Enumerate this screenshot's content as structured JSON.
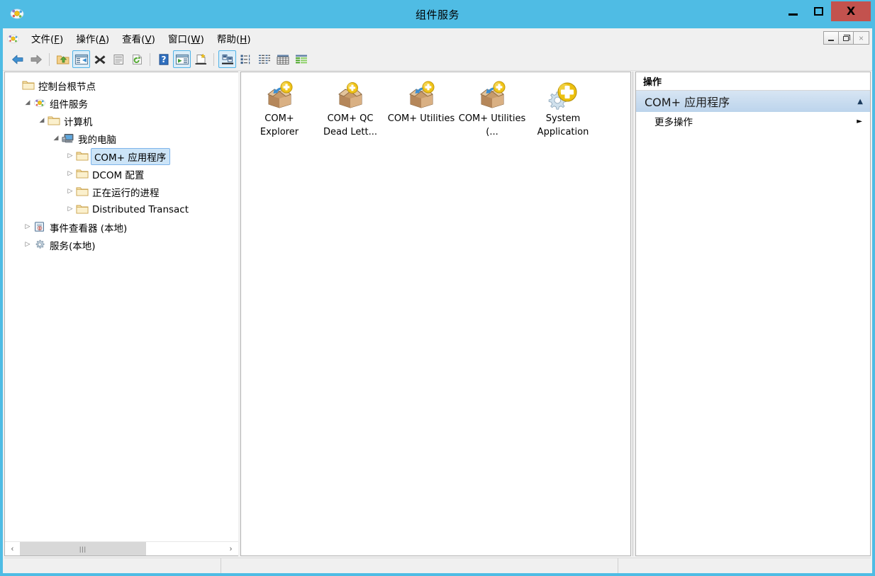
{
  "window": {
    "title": "组件服务",
    "icon": "mmc-component-services-icon",
    "frame_color": "#4fbce4",
    "close_button_color": "#c3524e",
    "controls": {
      "minimize": "最小化",
      "maximize": "最大化",
      "close": "X"
    }
  },
  "menu_bar": {
    "icon": "mmc-small-icon",
    "items": [
      {
        "label": "文件",
        "accel": "F"
      },
      {
        "label": "操作",
        "accel": "A"
      },
      {
        "label": "查看",
        "accel": "V"
      },
      {
        "label": "窗口",
        "accel": "W"
      },
      {
        "label": "帮助",
        "accel": "H"
      }
    ],
    "mdi_controls": {
      "minimize": "最小化",
      "restore": "还原",
      "close": "×"
    }
  },
  "toolbar": {
    "buttons": [
      {
        "name": "back-icon",
        "tip": "后退",
        "active": false
      },
      {
        "name": "forward-icon",
        "tip": "前进",
        "active": false
      },
      {
        "name": "up-one-level-icon",
        "tip": "向上一级",
        "active": false
      },
      {
        "name": "show-hide-tree-icon",
        "tip": "显示/隐藏控制台树",
        "active": true
      },
      {
        "name": "delete-icon",
        "tip": "删除",
        "active": false
      },
      {
        "name": "properties-icon",
        "tip": "属性",
        "active": false
      },
      {
        "name": "refresh-icon",
        "tip": "刷新",
        "active": false
      },
      {
        "name": "help-icon",
        "tip": "帮助",
        "active": false
      },
      {
        "name": "show-hide-action-pane-icon",
        "tip": "显示/隐藏操作窗格",
        "active": true
      },
      {
        "name": "new-window-icon",
        "tip": "新建窗口",
        "active": false
      },
      {
        "name": "view-large-icons-icon",
        "tip": "大图标",
        "active": true
      },
      {
        "name": "view-small-icons-icon",
        "tip": "小图标",
        "active": false
      },
      {
        "name": "view-list-icon",
        "tip": "列表",
        "active": false
      },
      {
        "name": "view-details-icon",
        "tip": "详细信息",
        "active": false
      },
      {
        "name": "view-tiles-icon",
        "tip": "平铺",
        "active": false
      }
    ]
  },
  "tree": {
    "nodes": [
      {
        "label": "控制台根节点",
        "depth": 0,
        "twisty": "",
        "icon": "folder-icon",
        "selected": false
      },
      {
        "label": "组件服务",
        "depth": 1,
        "twisty": "expanded",
        "icon": "component-services-icon",
        "selected": false
      },
      {
        "label": "计算机",
        "depth": 2,
        "twisty": "expanded",
        "icon": "folder-icon",
        "selected": false
      },
      {
        "label": "我的电脑",
        "depth": 3,
        "twisty": "expanded",
        "icon": "my-computer-icon",
        "selected": false
      },
      {
        "label": "COM+ 应用程序",
        "depth": 4,
        "twisty": "collapsed",
        "icon": "folder-icon",
        "selected": true
      },
      {
        "label": "DCOM 配置",
        "depth": 4,
        "twisty": "collapsed",
        "icon": "folder-icon",
        "selected": false
      },
      {
        "label": "正在运行的进程",
        "depth": 4,
        "twisty": "collapsed",
        "icon": "folder-icon",
        "selected": false
      },
      {
        "label": "Distributed Transact",
        "depth": 4,
        "twisty": "collapsed",
        "icon": "folder-icon",
        "selected": false
      },
      {
        "label": "事件查看器 (本地)",
        "depth": 1,
        "twisty": "collapsed",
        "icon": "event-viewer-icon",
        "selected": false
      },
      {
        "label": "服务(本地)",
        "depth": 1,
        "twisty": "collapsed",
        "icon": "services-gear-icon",
        "selected": false
      }
    ],
    "hscroll": {
      "left_arrow": "‹",
      "right_arrow": "›",
      "grip": "|||"
    }
  },
  "content": {
    "view_mode": "大图标",
    "items": [
      {
        "label": "COM+ Explorer",
        "icon": "com-plus-application-icon"
      },
      {
        "label": "COM+ QC Dead Lett...",
        "icon": "com-plus-application-icon"
      },
      {
        "label": "COM+ Utilities",
        "icon": "com-plus-application-icon"
      },
      {
        "label": "COM+ Utilities (...",
        "icon": "com-plus-application-icon"
      },
      {
        "label": "System Application",
        "icon": "com-plus-system-application-icon"
      }
    ]
  },
  "actions": {
    "header": "操作",
    "groups": [
      {
        "title": "COM+ 应用程序",
        "collapse_arrow": "▲",
        "items": [
          {
            "label": "更多操作",
            "submenu_arrow": "►"
          }
        ]
      }
    ]
  },
  "status_bar": {
    "cells": [
      "",
      "",
      ""
    ]
  }
}
